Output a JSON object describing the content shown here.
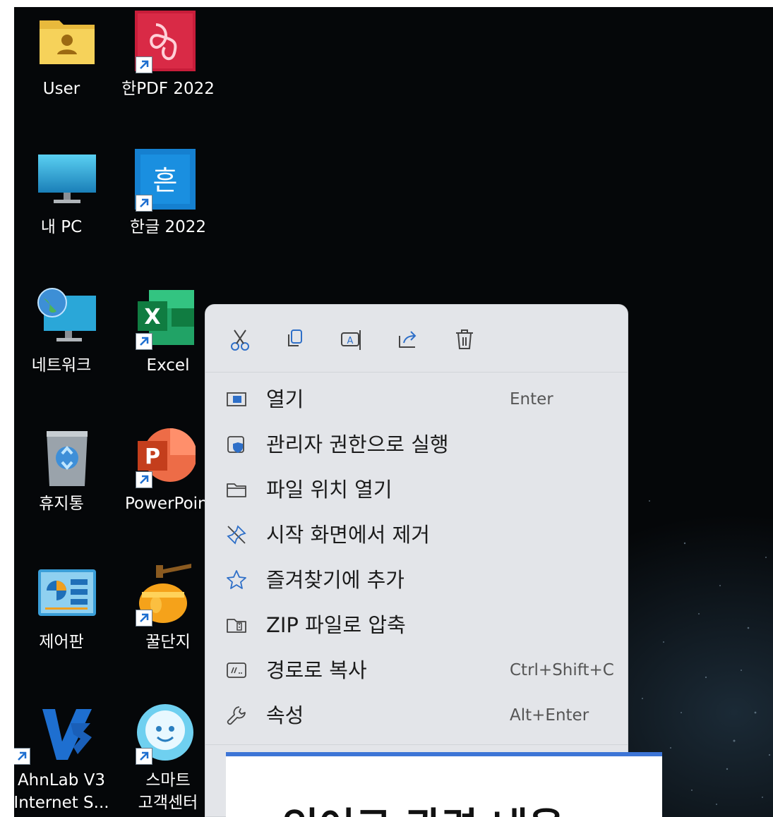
{
  "desktop": {
    "icons": [
      {
        "label": "User"
      },
      {
        "label": "한PDF 2022"
      },
      {
        "label": "내 PC"
      },
      {
        "label": "한글 2022"
      },
      {
        "label": "네트워크"
      },
      {
        "label": "Excel"
      },
      {
        "label": "휴지통"
      },
      {
        "label": "PowerPoint"
      },
      {
        "label": "제어판"
      },
      {
        "label": "꿀단지"
      },
      {
        "label_line1": "AhnLab V3",
        "label_line2": "Internet S..."
      },
      {
        "label_line1": "스마트",
        "label_line2": "고객센터"
      }
    ]
  },
  "context_menu": {
    "quick_actions": [
      "cut-icon",
      "copy-icon",
      "rename-icon",
      "share-icon",
      "delete-icon"
    ],
    "items": [
      {
        "label": "열기",
        "shortcut": "Enter",
        "icon": "open-icon"
      },
      {
        "label": "관리자 권한으로 실행",
        "shortcut": "",
        "icon": "shield-icon"
      },
      {
        "label": "파일 위치 열기",
        "shortcut": "",
        "icon": "folder-icon"
      },
      {
        "label": "시작 화면에서 제거",
        "shortcut": "",
        "icon": "unpin-icon"
      },
      {
        "label": "즐겨찾기에 추가",
        "shortcut": "",
        "icon": "star-icon"
      },
      {
        "label": "ZIP 파일로 압축",
        "shortcut": "",
        "icon": "zip-icon"
      },
      {
        "label": "경로로 복사",
        "shortcut": "Ctrl+Shift+C",
        "icon": "path-icon"
      },
      {
        "label": "속성",
        "shortcut": "Alt+Enter",
        "icon": "wrench-icon"
      }
    ]
  },
  "dialog": {
    "title": "있어로 관련 내용"
  },
  "colors": {
    "desktop_bg": "#050709",
    "menu_bg": "#e3e5e9",
    "accent": "#3d75d6"
  }
}
